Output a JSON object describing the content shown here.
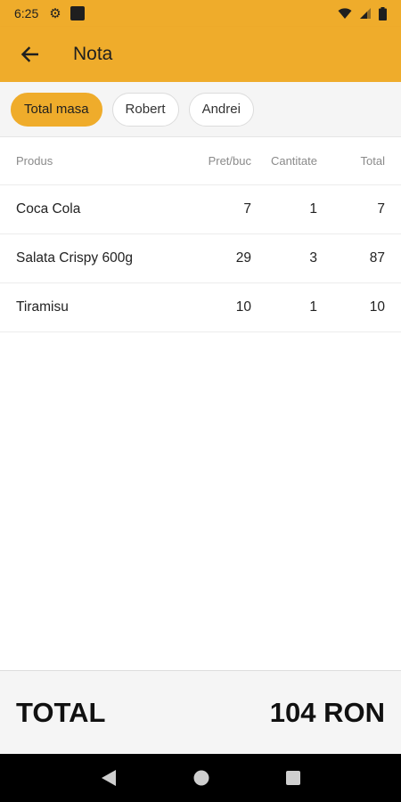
{
  "status_bar": {
    "time": "6:25",
    "icons": [
      "gear-icon",
      "app-square-icon",
      "wifi-icon",
      "signal-icon",
      "battery-icon"
    ]
  },
  "app_bar": {
    "title": "Nota",
    "back_icon": "arrow-back-icon"
  },
  "chips": [
    {
      "label": "Total masa",
      "active": true
    },
    {
      "label": "Robert",
      "active": false
    },
    {
      "label": "Andrei",
      "active": false
    }
  ],
  "table": {
    "headers": {
      "product": "Produs",
      "price": "Pret/buc",
      "qty": "Cantitate",
      "total": "Total"
    },
    "rows": [
      {
        "product": "Coca Cola",
        "price": "7",
        "qty": "1",
        "total": "7"
      },
      {
        "product": "Salata Crispy 600g",
        "price": "29",
        "qty": "3",
        "total": "87"
      },
      {
        "product": "Tiramisu",
        "price": "10",
        "qty": "1",
        "total": "10"
      }
    ]
  },
  "total": {
    "label": "TOTAL",
    "value": "104 RON"
  },
  "colors": {
    "accent": "#EFAC2B",
    "nav_bar": "#000000"
  }
}
